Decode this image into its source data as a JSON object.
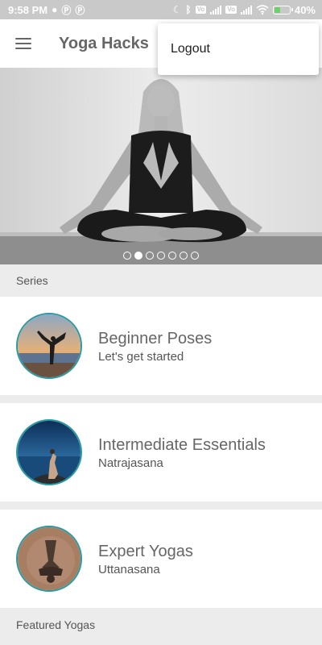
{
  "status_bar": {
    "time": "9:58 PM",
    "left_icons": [
      "spotify-icon",
      "p-notification-icon",
      "p-notification-icon"
    ],
    "right_icons": [
      "moon-icon",
      "bluetooth-icon",
      "volte-icon",
      "signal-icon",
      "volte-icon",
      "signal-icon",
      "wifi-icon",
      "battery-charging-icon"
    ],
    "volte_label": "Vo",
    "battery_percent": "40%",
    "battery_level": 0.4
  },
  "app_bar": {
    "title": "Yoga Hacks",
    "menu_icon": "hamburger-menu-icon"
  },
  "popup_menu": {
    "items": [
      {
        "label": "Logout"
      }
    ]
  },
  "hero": {
    "image": "woman-meditating-photo",
    "dots_total": 7,
    "dots_active_index": 1
  },
  "sections": {
    "series_label": "Series",
    "featured_label": "Featured Yogas"
  },
  "series": [
    {
      "title": "Beginner Poses",
      "subtitle": "Let's get started",
      "image": "beach-sunset-yoga-photo"
    },
    {
      "title": "Intermediate Essentials",
      "subtitle": "Natrajasana",
      "image": "ocean-yoga-photo"
    },
    {
      "title": "Expert Yogas",
      "subtitle": "Uttanasana",
      "image": "headstand-yoga-photo"
    }
  ]
}
